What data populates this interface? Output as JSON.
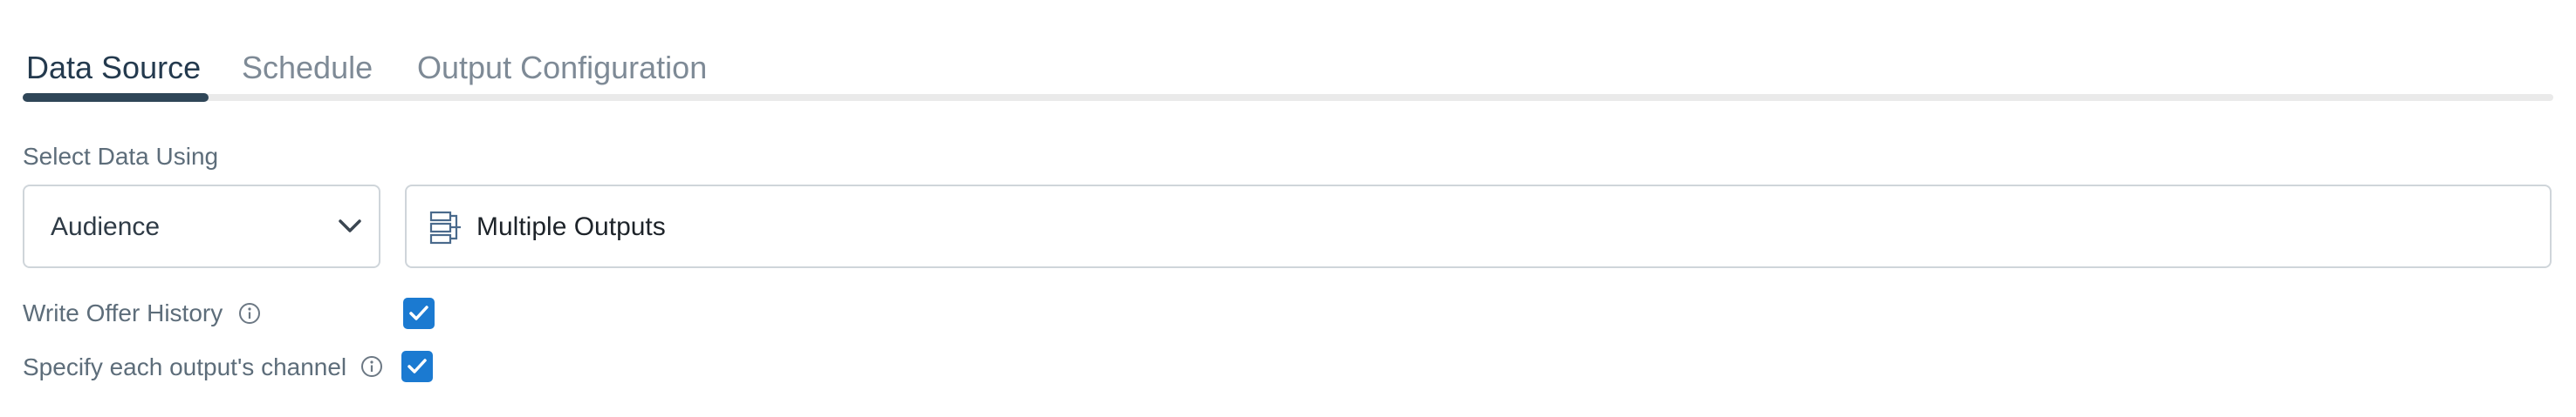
{
  "tabs": [
    {
      "label": "Data Source",
      "active": true
    },
    {
      "label": "Schedule",
      "active": false
    },
    {
      "label": "Output Configuration",
      "active": false
    }
  ],
  "data_source": {
    "select_label": "Select Data Using",
    "select_value": "Audience",
    "output_value": "Multiple Outputs",
    "output_icon": "layers-list-icon"
  },
  "options": {
    "write_offer_history": {
      "label": "Write Offer History",
      "checked": true
    },
    "specify_channel": {
      "label": "Specify each output's channel",
      "checked": true
    }
  },
  "colors": {
    "accent": "#1b7ad1",
    "active_tab": "#243a4e",
    "inactive_tab": "#7e8a96",
    "label": "#5d6d7a",
    "border": "#cfd5da"
  }
}
